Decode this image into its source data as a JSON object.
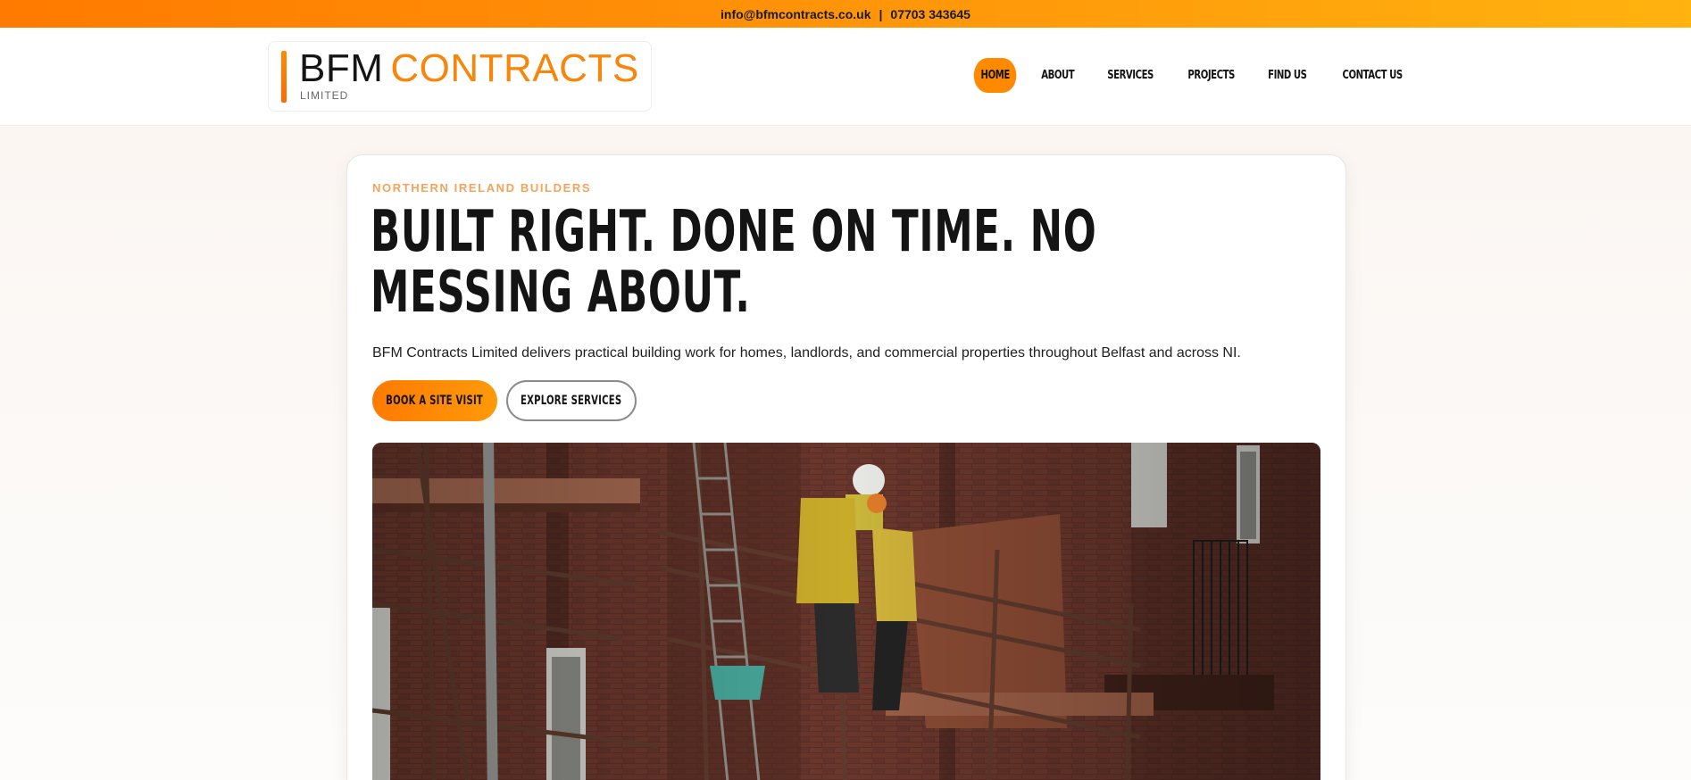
{
  "topbar": {
    "email": "info@bfmcontracts.co.uk",
    "separator": "|",
    "phone": "07703 343645"
  },
  "logo": {
    "brand_part1": "BFM",
    "brand_part2": "CONTRACTS",
    "subtitle": "LIMITED"
  },
  "nav": {
    "items": [
      {
        "label": "HOME",
        "active": true
      },
      {
        "label": "ABOUT",
        "active": false
      },
      {
        "label": "SERVICES",
        "active": false
      },
      {
        "label": "PROJECTS",
        "active": false
      },
      {
        "label": "FIND US",
        "active": false
      },
      {
        "label": "CONTACT US",
        "active": false
      }
    ]
  },
  "hero": {
    "eyebrow": "NORTHERN IRELAND BUILDERS",
    "headline": "BUILT RIGHT. DONE ON TIME. NO MESSING ABOUT.",
    "lead": "BFM Contracts Limited delivers practical building work for homes, landlords, and commercial properties throughout Belfast and across NI.",
    "primary_button": "BOOK A SITE VISIT",
    "secondary_button": "EXPLORE SERVICES"
  },
  "colors": {
    "accent": "#ff8a00",
    "brand_orange": "#f7860a",
    "eyebrow": "#f5a35a",
    "text": "#141414"
  }
}
